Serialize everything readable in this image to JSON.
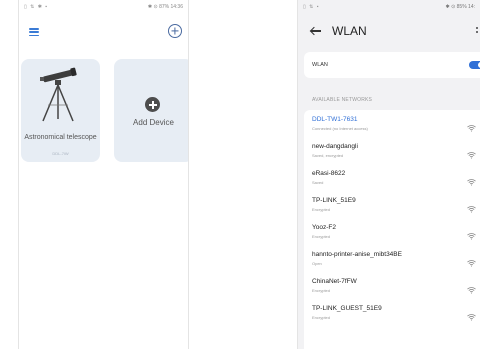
{
  "left_screen": {
    "status_bar": {
      "left": "▯ ⇅ ✱ ▪",
      "right": "✱ ⊙ 87% 14:36"
    },
    "devices": [
      {
        "name": "Astronomical telescope",
        "subtitle": "DDL-7iW"
      }
    ],
    "add_device_label": "Add Device"
  },
  "right_screen": {
    "status_bar": {
      "left": "▯ ⇅ ▪",
      "right": "✱ ⊙ 85% 14:"
    },
    "title": "WLAN",
    "wlan_toggle_label": "WLAN",
    "wlan_enabled": true,
    "section_label": "AVAILABLE NETWORKS",
    "accent_color": "#2f6fd6",
    "networks": [
      {
        "name": "DDL-TW1-7631",
        "status": "Connected (no Internet access)",
        "connected": true
      },
      {
        "name": "new-dangdangli",
        "status": "Saved, encrypted",
        "connected": false
      },
      {
        "name": "eRasi-8622",
        "status": "Saved",
        "connected": false
      },
      {
        "name": "TP-LINK_51E9",
        "status": "Encrypted",
        "connected": false
      },
      {
        "name": "Yooz-F2",
        "status": "Encrypted",
        "connected": false
      },
      {
        "name": "hannto-printer-anise_mibt34BE",
        "status": "Open",
        "connected": false
      },
      {
        "name": "ChinaNet-7fFW",
        "status": "Encrypted",
        "connected": false
      },
      {
        "name": "TP-LINK_GUEST_51E9",
        "status": "Encrypted",
        "connected": false
      }
    ]
  }
}
